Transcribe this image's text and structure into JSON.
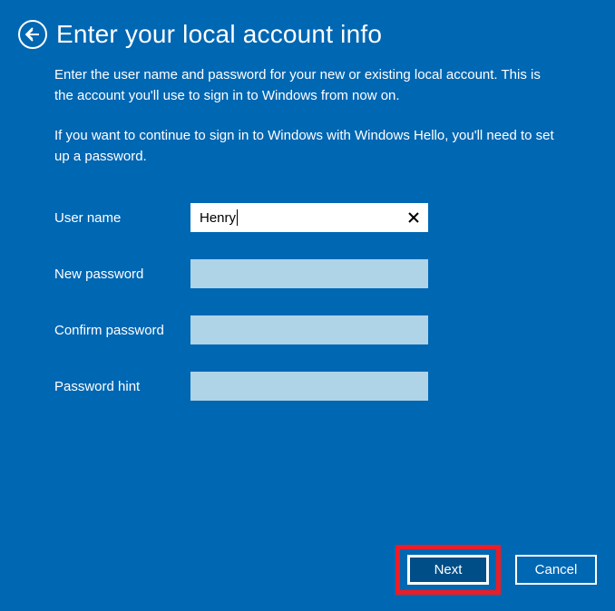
{
  "header": {
    "title": "Enter your local account info"
  },
  "descriptions": {
    "line1": "Enter the user name and password for your new or existing local account. This is the account you'll use to sign in to Windows from now on.",
    "line2": "If you want to continue to sign in to Windows with Windows Hello, you'll need to set up a password."
  },
  "form": {
    "username_label": "User name",
    "username_value": "Henry",
    "new_password_label": "New password",
    "new_password_value": "",
    "confirm_password_label": "Confirm password",
    "confirm_password_value": "",
    "password_hint_label": "Password hint",
    "password_hint_value": ""
  },
  "buttons": {
    "next": "Next",
    "cancel": "Cancel"
  }
}
